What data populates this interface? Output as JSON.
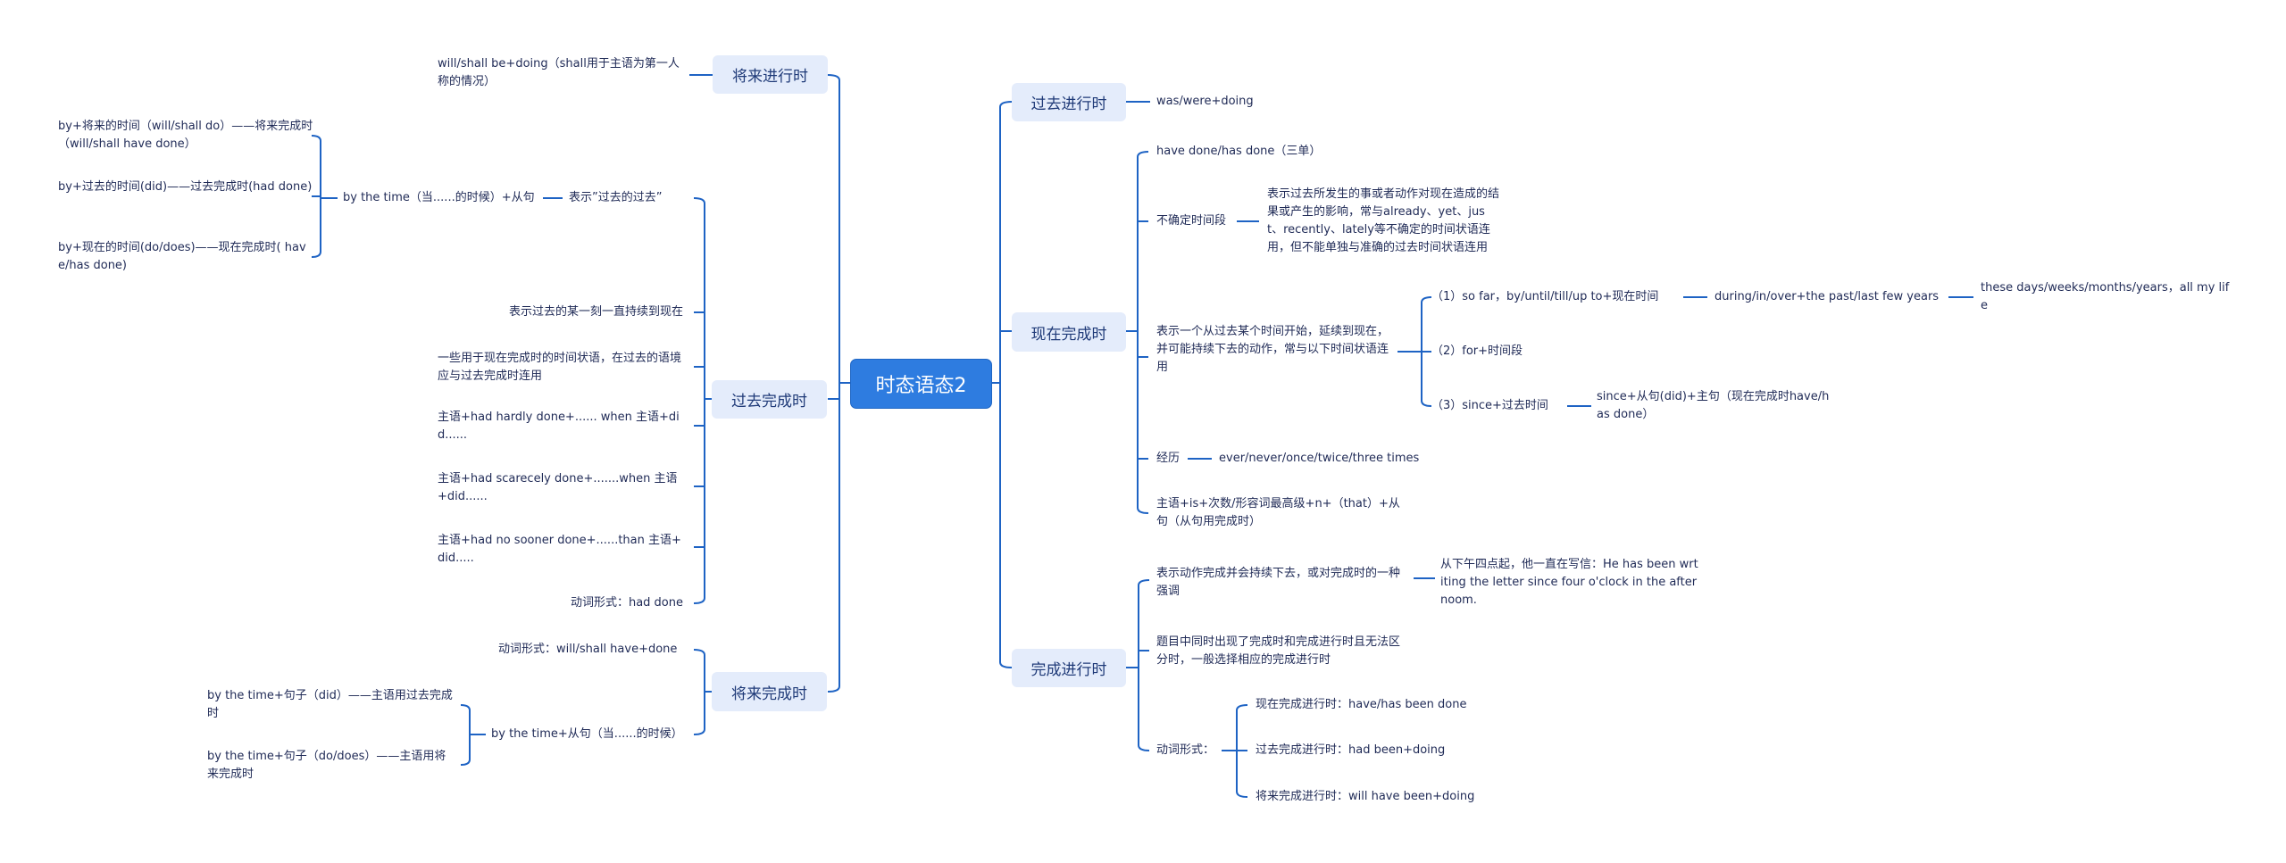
{
  "root": "时态语态2",
  "colors": {
    "line": "#1e63c4",
    "root_bg": "#2e7ce0",
    "topic_bg": "#e4ecfb",
    "text": "#1f2a56"
  },
  "left": {
    "future_progressive": {
      "title": "将来进行时",
      "items": [
        "will/shall be+doing（shall用于主语为第一人称的情况）"
      ]
    },
    "past_perfect": {
      "title": "过去完成时",
      "by_the_time": {
        "meaning": "表示”过去的过去”",
        "label": "by the time（当......的时候）+从句",
        "items": [
          "by+将来的时间（will/shall do）——将来完成时（will/shall have done）",
          "by+过去的时间(did)——过去完成时(had done)",
          "by+现在的时间(do/does)——现在完成时( have/has done)"
        ]
      },
      "items": [
        "表示过去的某一刻一直持续到现在",
        "一些用于现在完成时的时间状语，在过去的语境应与过去完成时连用",
        "主语+had hardly done+...... when 主语+did......",
        "主语+had scarecely done+.......when 主语+did......",
        "主语+had no sooner done+......than 主语+did.....",
        "动词形式：had done"
      ]
    },
    "future_perfect": {
      "title": "将来完成时",
      "verb_form": "动词形式：will/shall have+done",
      "by_the_time": {
        "label": "by the time+从句（当......的时候）",
        "items": [
          "by the time+句子（did）——主语用过去完成时",
          "by the time+句子（do/does）——主语用将来完成时"
        ]
      }
    }
  },
  "right": {
    "past_progressive": {
      "title": "过去进行时",
      "items": [
        "was/were+doing"
      ]
    },
    "present_perfect": {
      "title": "现在完成时",
      "form": "have done/has done（三单）",
      "indefinite": {
        "label": "不确定时间段",
        "detail": "表示过去所发生的事或者动作对现在造成的结果或产生的影响，常与already、yet、just、recently、lately等不确定的时间状语连用，但不能单独与准确的过去时间状语连用"
      },
      "continuing": {
        "label": "表示一个从过去某个时间开始，延续到现在，并可能持续下去的动作，常与以下时间状语连用",
        "items": [
          {
            "label": "（1）so far，by/until/till/up to+现在时间",
            "next": "during/in/over+the past/last few years",
            "next2": "these days/weeks/months/years，all my life"
          },
          {
            "label": "（2）for+时间段"
          },
          {
            "label": "（3）since+过去时间",
            "next": "since+从句(did)+主句（现在完成时have/has done）"
          }
        ]
      },
      "experience": {
        "label": "经历",
        "detail": "ever/never/once/twice/three times"
      },
      "superlative": "主语+is+次数/形容词最高级+n+（that）+从句（从句用完成时）"
    },
    "perfect_progressive": {
      "title": "完成进行时",
      "emphasis": {
        "label": "表示动作完成并会持续下去，或对完成时的一种强调",
        "example": "从下午四点起，他一直在写信：He has been  wrtiting the letter since four o'clock in the afternoom."
      },
      "choice": "题目中同时出现了完成时和完成进行时且无法区分时，一般选择相应的完成进行时",
      "verb_form": {
        "label": "动词形式：",
        "items": [
          "现在完成进行时：have/has been done",
          "过去完成进行时：had been+doing",
          "将来完成进行时：will have been+doing"
        ]
      }
    }
  }
}
